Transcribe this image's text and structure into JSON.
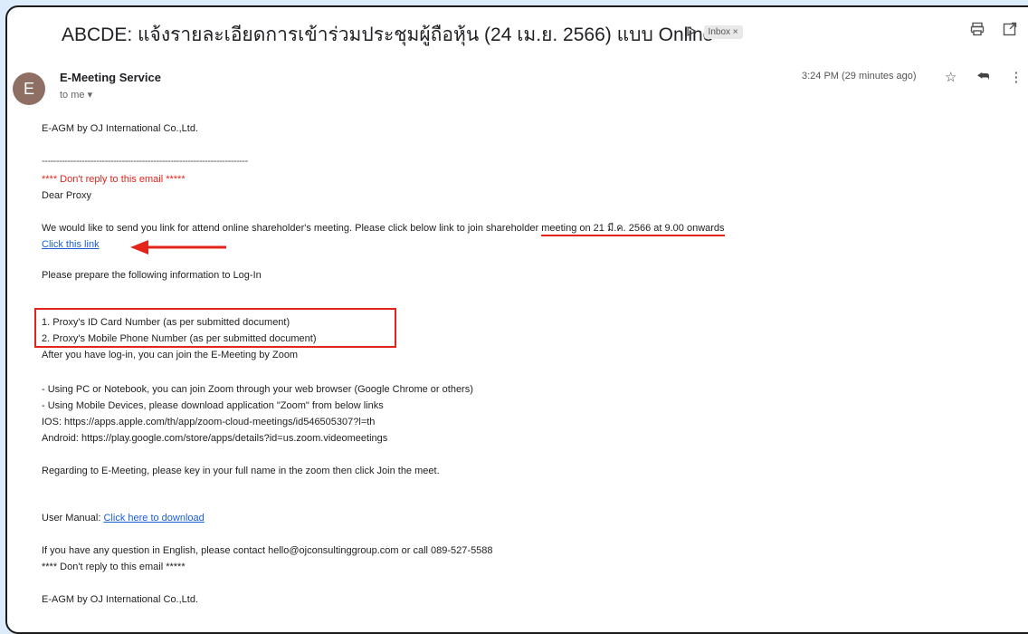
{
  "header": {
    "subject": "ABCDE: แจ้งรายละเอียดการเข้าร่วมประชุมผู้ถือหุ้น (24 เม.ย. 2566) แบบ Online",
    "label_icon": "label-icon",
    "inbox_label": "Inbox ×",
    "icons": [
      "print-icon",
      "open-in-new-icon"
    ]
  },
  "message": {
    "avatar_letter": "E",
    "sender": "E-Meeting Service",
    "to": "to me ▾",
    "time": "3:24 PM (29 minutes ago)",
    "icons": [
      "star-icon",
      "reply-icon",
      "more-icon"
    ]
  },
  "body": {
    "company_line": "E-AGM by OJ International Co.,Ltd.",
    "divider": "------------------------------------------------------------------------",
    "warning": "**** Don't reply to this email *****",
    "greeting": "Dear Proxy",
    "intro": "We would like to send you link for attend online shareholder's meeting. Please click below link to join shareholder ",
    "intro_highlight": "meeting on 21 มี.ค. 2566 at 9.00 onwards",
    "link_text": "Click this link",
    "prepare": "Please prepare the following information to Log-In",
    "item1": "1. Proxy's ID Card Number (as per submitted document)",
    "item2": "2. Proxy's Mobile Phone Number (as per submitted document)",
    "after_login": "After you have log-in, you can join the E-Meeting by Zoom",
    "pc": "- Using PC or Notebook, you can join Zoom through your web browser (Google Chrome or others)",
    "mobile": "- Using Mobile Devices, please download application \"Zoom\" from below links",
    "ios": "IOS: https://apps.apple.com/th/app/zoom-cloud-meetings/id546505307?l=th",
    "android": "Android: https://play.google.com/store/apps/details?id=us.zoom.videomeetings",
    "regarding": "Regarding to E-Meeting, please key in your full name in the zoom then click Join the meet.",
    "manual_label": "User Manual: ",
    "manual_link": "Click here to download",
    "question": "If you have any question in English, please contact hello@ojconsultinggroup.com or call 089-527-5588",
    "warning2": "**** Don't reply to this email *****",
    "company_line2": "E-AGM by OJ International Co.,Ltd."
  },
  "colors": {
    "annotation": "#e3241b",
    "link": "#1a5fd6",
    "page_bg": "#dcecfa"
  }
}
